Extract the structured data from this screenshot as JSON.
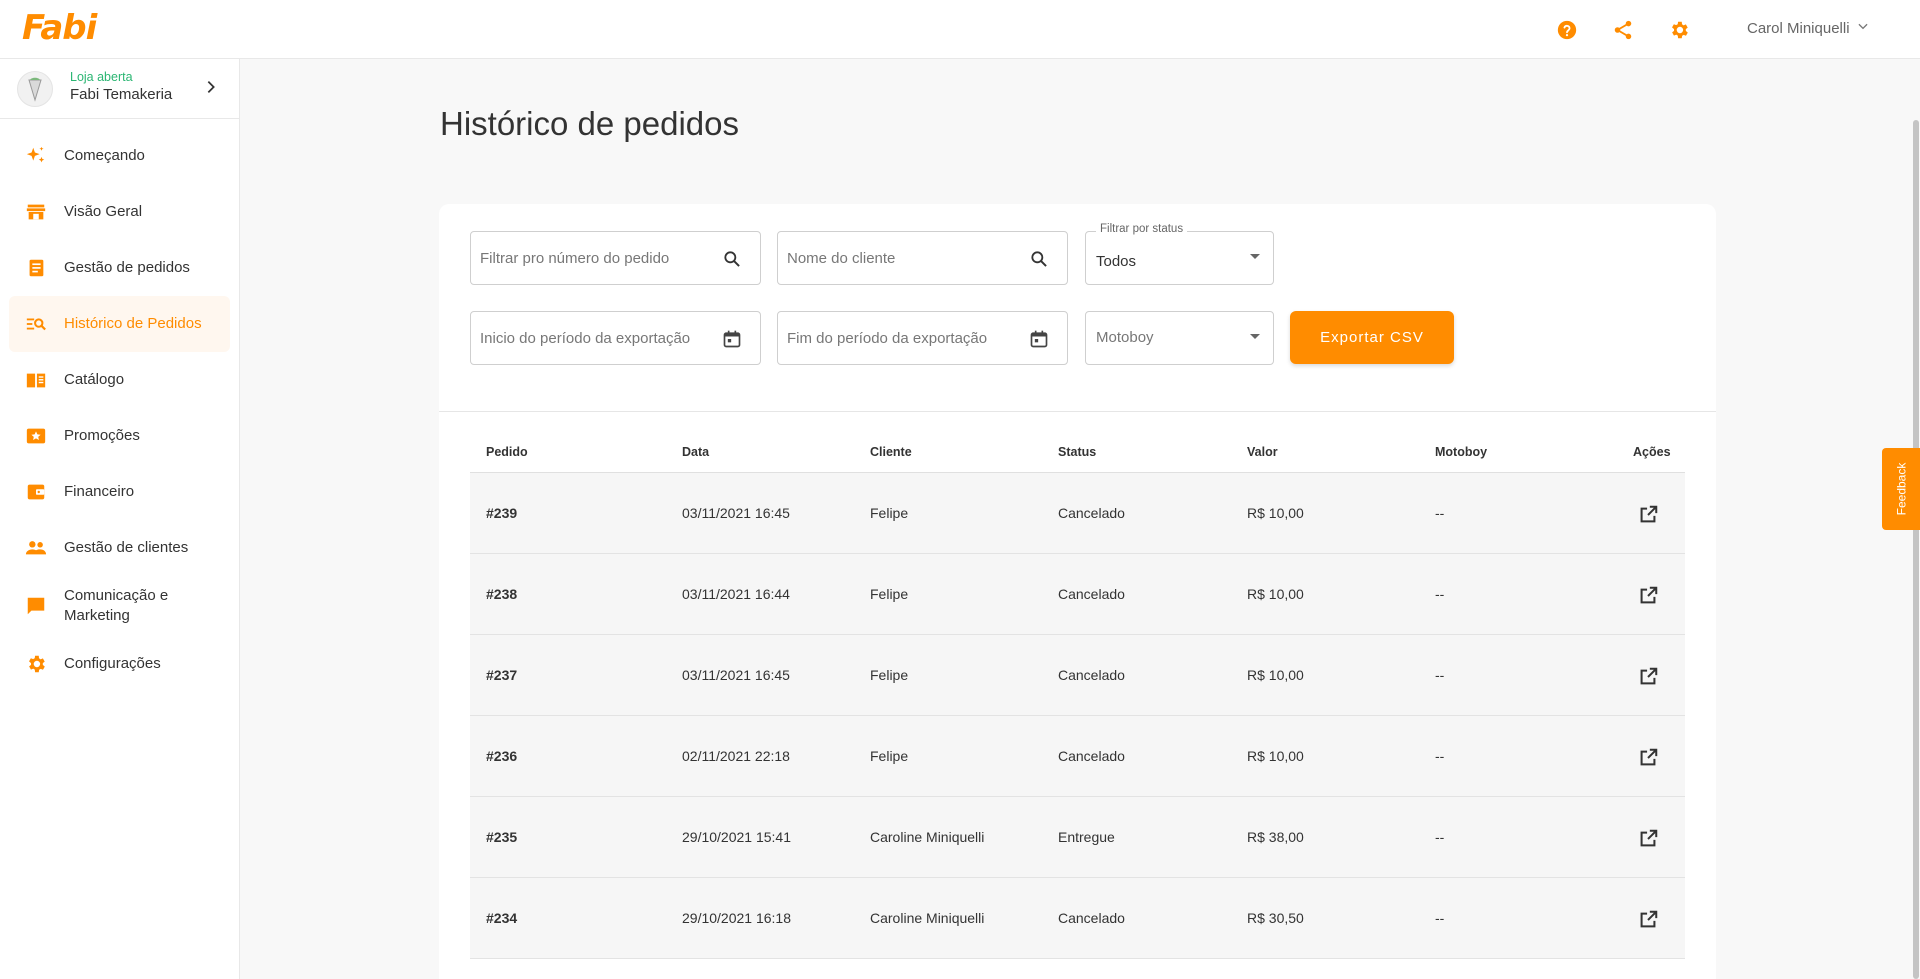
{
  "brand": {
    "logo": "Fabi",
    "accent": "#ff8c00"
  },
  "header": {
    "user_name": "Carol Miniquelli",
    "icons": [
      "help-icon",
      "share-icon",
      "settings-icon"
    ]
  },
  "store": {
    "status": "Loja aberta",
    "name": "Fabi Temakeria"
  },
  "sidebar": {
    "items": [
      {
        "label": "Começando",
        "icon": "sparkle-icon"
      },
      {
        "label": "Visão Geral",
        "icon": "store-icon"
      },
      {
        "label": "Gestão de pedidos",
        "icon": "orders-icon"
      },
      {
        "label": "Histórico de Pedidos",
        "icon": "history-search-icon",
        "active": true
      },
      {
        "label": "Catálogo",
        "icon": "book-icon"
      },
      {
        "label": "Promoções",
        "icon": "star-ticket-icon"
      },
      {
        "label": "Financeiro",
        "icon": "wallet-icon"
      },
      {
        "label": "Gestão de clientes",
        "icon": "people-icon"
      },
      {
        "label": "Comunicação e Marketing",
        "icon": "chat-icon"
      },
      {
        "label": "Configurações",
        "icon": "settings-icon"
      }
    ]
  },
  "page": {
    "title": "Histórico de pedidos"
  },
  "filters": {
    "order_number_placeholder": "Filtrar pro número do pedido",
    "client_name_placeholder": "Nome do cliente",
    "status_label": "Filtrar por status",
    "status_value": "Todos",
    "start_period_placeholder": "Inicio do período da exportação",
    "end_period_placeholder": "Fim do período da exportação",
    "motoboy_placeholder": "Motoboy",
    "export_label": "Exportar CSV"
  },
  "table": {
    "headers": [
      "Pedido",
      "Data",
      "Cliente",
      "Status",
      "Valor",
      "Motoboy",
      "Ações"
    ],
    "rows": [
      [
        "#239",
        "03/11/2021 16:45",
        "Felipe",
        "Cancelado",
        "R$ 10,00",
        "--"
      ],
      [
        "#238",
        "03/11/2021 16:44",
        "Felipe",
        "Cancelado",
        "R$ 10,00",
        "--"
      ],
      [
        "#237",
        "03/11/2021 16:45",
        "Felipe",
        "Cancelado",
        "R$ 10,00",
        "--"
      ],
      [
        "#236",
        "02/11/2021 22:18",
        "Felipe",
        "Cancelado",
        "R$ 10,00",
        "--"
      ],
      [
        "#235",
        "29/10/2021 15:41",
        "Caroline Miniquelli",
        "Entregue",
        "R$ 38,00",
        "--"
      ],
      [
        "#234",
        "29/10/2021 16:18",
        "Caroline Miniquelli",
        "Cancelado",
        "R$ 30,50",
        "--"
      ]
    ]
  },
  "feedback": {
    "label": "Feedback"
  }
}
